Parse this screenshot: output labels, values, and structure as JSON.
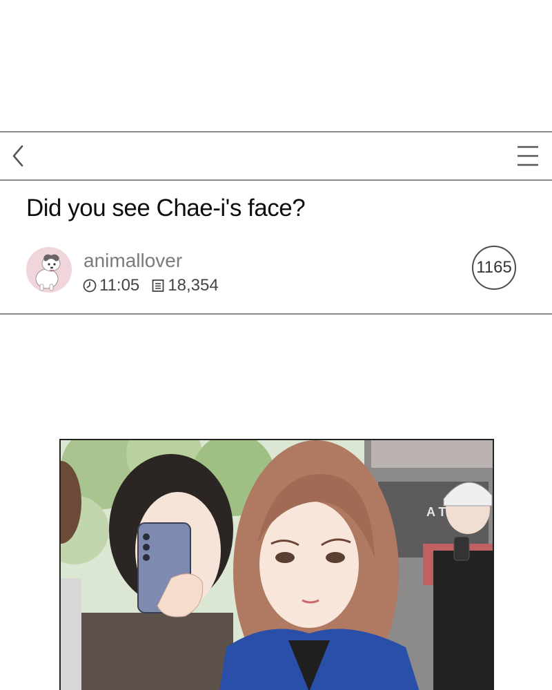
{
  "post": {
    "title": "Did you see Chae-i's face?",
    "author": "animallover",
    "time": "11:05",
    "views": "18,354",
    "comments": "1165"
  },
  "icons": {
    "back": "chevron-left-icon",
    "menu": "hamburger-menu-icon",
    "time": "clock-icon",
    "views": "document-icon"
  },
  "comic": {
    "sign_text": "A T"
  },
  "colors": {
    "divider": "#8a8a8a",
    "title": "#0d0d0d",
    "author": "#7a7a7a",
    "meta": "#444444"
  }
}
